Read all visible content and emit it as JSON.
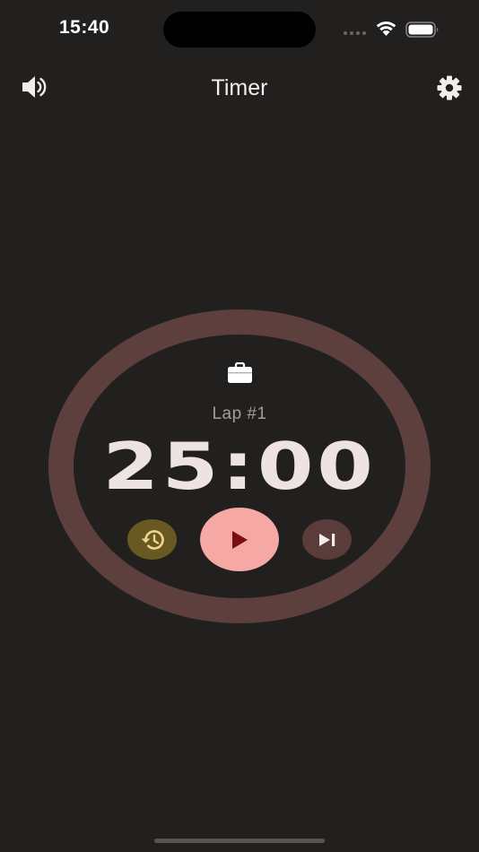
{
  "status_bar": {
    "time": "15:40"
  },
  "nav": {
    "title": "Timer",
    "left_icon": "speaker-icon",
    "right_icon": "gear-icon"
  },
  "timer": {
    "mode_icon": "briefcase-icon",
    "lap_label": "Lap #1",
    "time_display": "25:00"
  },
  "controls": {
    "history_icon": "history-icon",
    "play_icon": "play-icon",
    "skip_icon": "skip-next-icon"
  },
  "colors": {
    "background": "#221f1f",
    "ring": "#5d403e",
    "play_button": "#f5a8a4",
    "play_glyph": "#7a0f12",
    "history_button": "#685822",
    "history_glyph": "#f0d489",
    "skip_button": "#5a3c3b",
    "text_primary": "#ede3e1",
    "text_secondary": "#a59c9b"
  }
}
